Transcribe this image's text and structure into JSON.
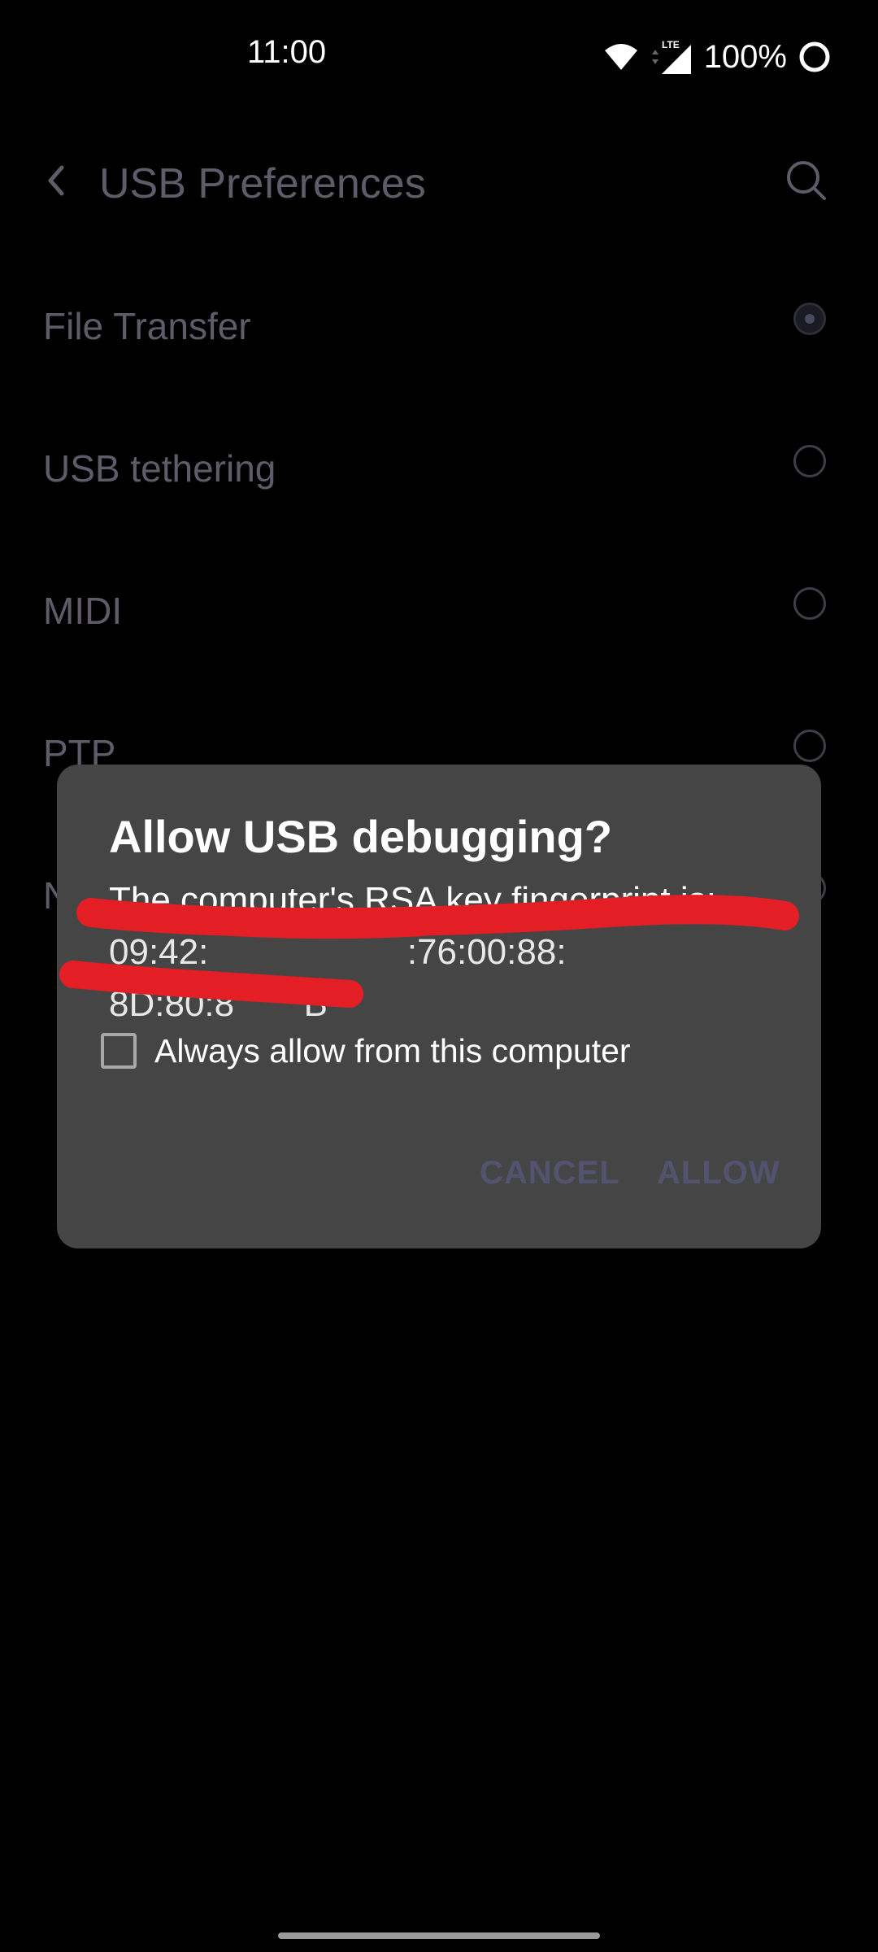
{
  "status_bar": {
    "time": "11:00",
    "network_label": "LTE",
    "battery": "100%"
  },
  "toolbar": {
    "title": "USB Preferences",
    "back_icon": "back-chevron-icon",
    "search_icon": "search-icon"
  },
  "usb_options": [
    {
      "label": "File Transfer",
      "selected": true
    },
    {
      "label": "USB tethering",
      "selected": false
    },
    {
      "label": "MIDI",
      "selected": false
    },
    {
      "label": "PTP",
      "selected": false
    },
    {
      "label": "N",
      "selected": false
    }
  ],
  "dialog": {
    "title": "Allow USB debugging?",
    "message": "The computer's RSA key fingerprint is:",
    "fingerprint_line1": "09:42:                    :76:00:88:",
    "fingerprint_line2": "8D:80:8       B",
    "checkbox_label": "Always allow from this computer",
    "checkbox_checked": false,
    "cancel_label": "CANCEL",
    "allow_label": "ALLOW"
  },
  "colors": {
    "background": "#000000",
    "dialog": "#454545",
    "redaction": "#e31e24",
    "button_text": "#535370"
  }
}
